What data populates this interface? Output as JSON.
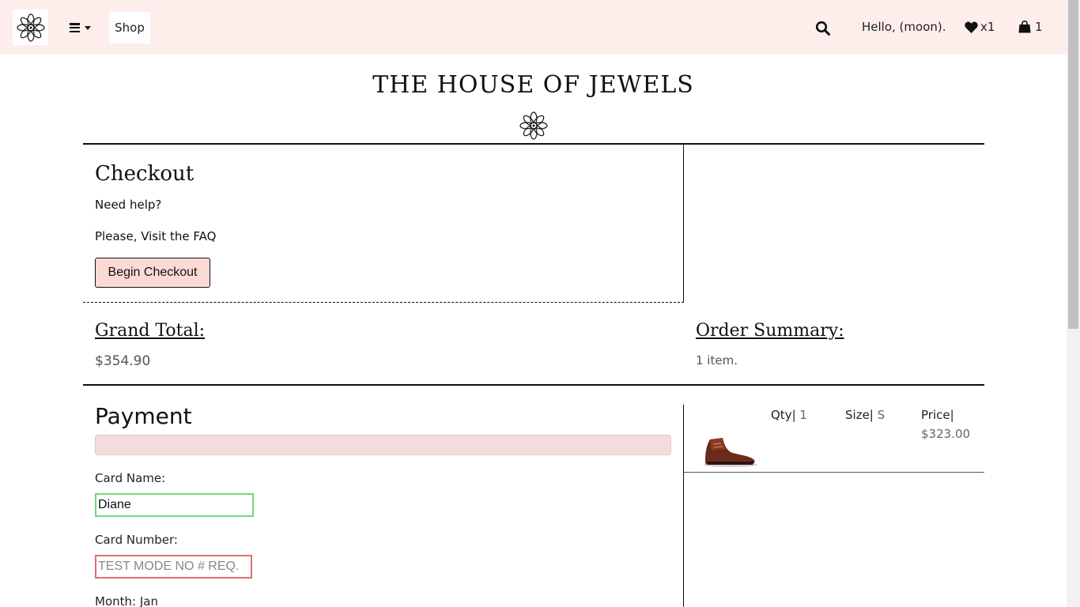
{
  "navbar": {
    "shop_label": "Shop",
    "greeting": "Hello, (moon).",
    "wishlist_count": "x1",
    "bag_count": "1",
    "background": "#fdeeec"
  },
  "brand": {
    "title": "THE HOUSE OF JEWELS"
  },
  "checkout": {
    "title": "Checkout",
    "need_help": "Need help?",
    "faq_text": "Please, Visit the FAQ",
    "begin_button": "Begin Checkout",
    "button_color": "#fdd9d6"
  },
  "totals": {
    "grand_label": "Grand Total:",
    "grand_value": "$354.90",
    "summary_label": "Order Summary:",
    "summary_value": "1 item."
  },
  "payment": {
    "title": "Payment",
    "card_name_label": "Card Name:",
    "card_name_value": "Diane",
    "card_number_label": "Card Number:",
    "card_number_placeholder": "TEST MODE NO # REQ.",
    "month_label": "Month: Jan",
    "valid_color": "#6cdb75",
    "invalid_color": "#e06d76"
  },
  "order_item": {
    "qty_label": "Qty|",
    "qty_value": "1",
    "size_label": "Size|",
    "size_value": "S",
    "price_label": "Price|",
    "price_value": "$323.00",
    "image": "brown-leather-boot"
  }
}
